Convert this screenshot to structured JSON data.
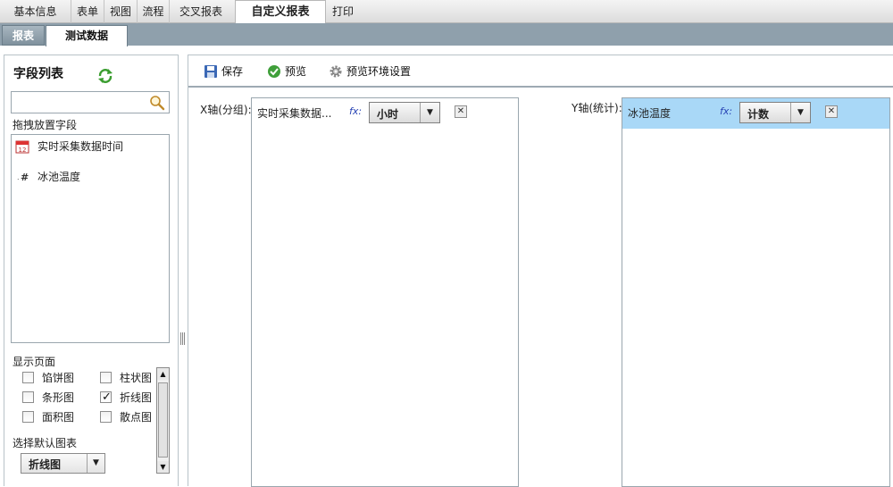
{
  "top_tabs": [
    "基本信息",
    "表单",
    "视图",
    "流程",
    "交叉报表",
    "自定义报表",
    "打印"
  ],
  "active_top_tab": "自定义报表",
  "sub_tabs": [
    "报表",
    "测试数据"
  ],
  "active_sub_tab": "测试数据",
  "field_panel": {
    "title": "字段列表",
    "search_placeholder": "",
    "drag_label": "拖拽放置字段",
    "fields": [
      {
        "label": "实时采集数据时间",
        "icon": "calendar-icon"
      },
      {
        "label": "冰池温度",
        "icon": "number-field-icon"
      }
    ],
    "display_label": "显示页面",
    "chart_types": [
      {
        "label": "馅饼图",
        "checked": false
      },
      {
        "label": "柱状图",
        "checked": false
      },
      {
        "label": "条形图",
        "checked": false
      },
      {
        "label": "折线图",
        "checked": true
      },
      {
        "label": "面积图",
        "checked": false
      },
      {
        "label": "散点图",
        "checked": false
      }
    ],
    "default_chart_label": "选择默认图表",
    "default_chart_value": "折线图"
  },
  "toolbar": {
    "save_label": "保存",
    "preview_label": "预览",
    "preview_settings_label": "预览环境设置"
  },
  "x_axis": {
    "label": "X轴(分组):",
    "field": "实时采集数据...",
    "fx": "fx:",
    "aggregation": "小时"
  },
  "y_axis": {
    "label": "Y轴(统计):",
    "field": "冰池温度",
    "fx": "fx:",
    "aggregation": "计数"
  },
  "colors": {
    "accent_tab_bar": "#8fa0ac",
    "selected_row": "#a9d8f7",
    "fx_text": "#2a45b5"
  }
}
